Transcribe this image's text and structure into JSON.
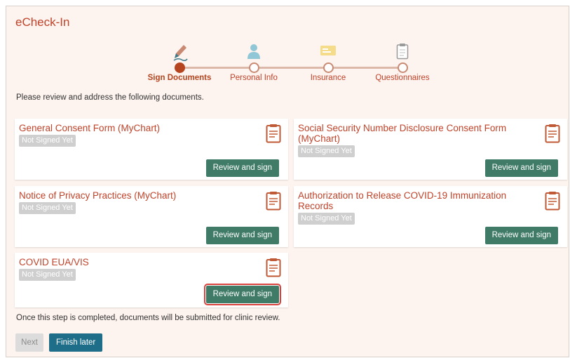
{
  "app": {
    "title": "eCheck-In"
  },
  "stepper": {
    "steps": [
      {
        "label": "Sign Documents",
        "icon": "pen-icon",
        "active": true
      },
      {
        "label": "Personal Info",
        "icon": "person-icon",
        "active": false
      },
      {
        "label": "Insurance",
        "icon": "insurance-card-icon",
        "active": false
      },
      {
        "label": "Questionnaires",
        "icon": "clipboard-icon",
        "active": false
      }
    ]
  },
  "instructions": "Please review and address the following documents.",
  "documents": [
    {
      "title": "General Consent Form (MyChart)",
      "status": "Not Signed Yet",
      "action": "Review and sign"
    },
    {
      "title": "Social Security Number Disclosure Consent Form (MyChart)",
      "status": "Not Signed Yet",
      "action": "Review and sign"
    },
    {
      "title": "Notice of Privacy Practices (MyChart)",
      "status": "Not Signed Yet",
      "action": "Review and sign"
    },
    {
      "title": "Authorization to Release COVID-19 Immunization Records",
      "status": "Not Signed Yet",
      "action": "Review and sign"
    },
    {
      "title": "COVID EUA/VIS",
      "status": "Not Signed Yet",
      "action": "Review and sign"
    }
  ],
  "footer_note": "Once this step is completed, documents will be submitted for clinic review.",
  "buttons": {
    "next": "Next",
    "finish_later": "Finish later"
  },
  "colors": {
    "accent": "#c0432a",
    "sign_button": "#3f7b66",
    "finish_button": "#1e6e89",
    "highlight": "#d9413d"
  }
}
